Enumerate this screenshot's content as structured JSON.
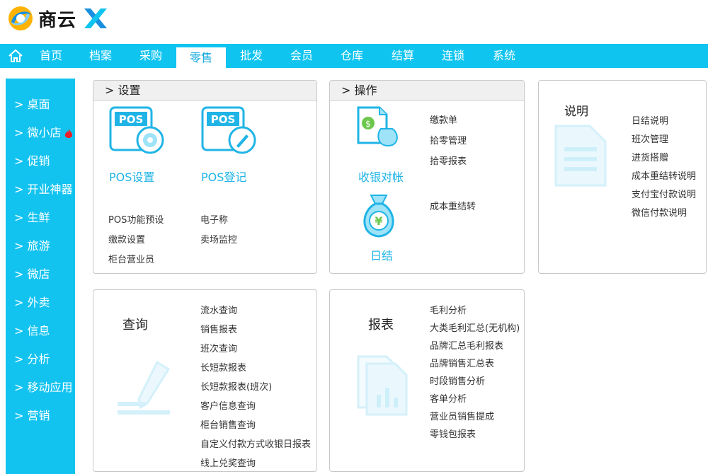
{
  "logo": {
    "text": "商云"
  },
  "nav": {
    "items": [
      "首页",
      "档案",
      "采购",
      "零售",
      "批发",
      "会员",
      "仓库",
      "结算",
      "连锁",
      "系统"
    ],
    "active_index": 3
  },
  "sidebar": {
    "items": [
      "> 桌面",
      "> 微小店",
      "> 促销",
      "> 开业神器",
      "> 生鲜",
      "> 旅游",
      "> 微店",
      "> 外卖",
      "> 信息",
      "> 分析",
      "> 移动应用",
      "> 营销"
    ]
  },
  "settings": {
    "title": ">  设置",
    "pos_settings_label": "POS设置",
    "pos_register_label": "POS登记",
    "pos_icon_text": "POS",
    "links": [
      "POS功能预设",
      "缴款设置",
      "柜台营业员",
      "电子称",
      "卖场监控"
    ]
  },
  "operations": {
    "title": ">  操作",
    "reconcile_label": "收银对帐",
    "daily_close_label": "日结",
    "links": [
      "缴款单",
      "拾零管理",
      "拾零报表",
      "成本重结转"
    ]
  },
  "notes": {
    "title": "说明",
    "links": [
      "日结说明",
      "班次管理",
      "进货搭赠",
      "成本重结转说明",
      "支付宝付款说明",
      "微信付款说明"
    ]
  },
  "query": {
    "title": "查询",
    "links": [
      "流水查询",
      "销售报表",
      "班次查询",
      "长短款报表",
      "长短款报表(班次)",
      "客户信息查询",
      "柜台销售查询",
      "自定义付款方式收银日报表",
      "线上兑奖查询"
    ]
  },
  "reports": {
    "title": "报表",
    "links": [
      "毛利分析",
      "大类毛利汇总(无机构)",
      "品牌汇总毛利报表",
      "品牌销售汇总表",
      "时段销售分析",
      "客单分析",
      "营业员销售提成",
      "零钱包报表"
    ]
  },
  "colors": {
    "accent": "#10c4f0",
    "accent_text": "#20b4e6"
  }
}
